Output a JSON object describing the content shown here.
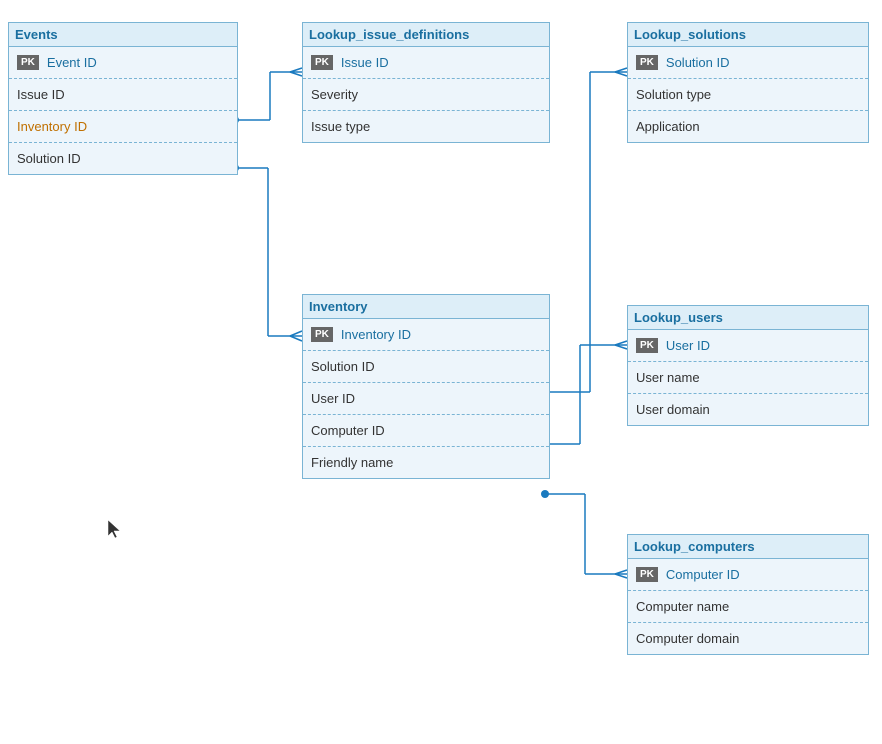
{
  "tables": {
    "events": {
      "title": "Events",
      "fields": [
        {
          "name": "Event ID",
          "type": "pk",
          "pk": true
        },
        {
          "name": "Issue ID",
          "type": "fk"
        },
        {
          "name": "Inventory ID",
          "type": "fk"
        },
        {
          "name": "Solution ID",
          "type": "fk"
        }
      ]
    },
    "lookup_issue_definitions": {
      "title": "Lookup_issue_definitions",
      "fields": [
        {
          "name": "Issue ID",
          "type": "pk",
          "pk": true
        },
        {
          "name": "Severity",
          "type": "normal"
        },
        {
          "name": "Issue type",
          "type": "normal"
        }
      ]
    },
    "lookup_solutions": {
      "title": "Lookup_solutions",
      "fields": [
        {
          "name": "Solution ID",
          "type": "pk",
          "pk": true
        },
        {
          "name": "Solution type",
          "type": "normal"
        },
        {
          "name": "Application",
          "type": "normal"
        }
      ]
    },
    "inventory": {
      "title": "Inventory",
      "fields": [
        {
          "name": "Inventory ID",
          "type": "pk",
          "pk": true
        },
        {
          "name": "Solution ID",
          "type": "fk"
        },
        {
          "name": "User ID",
          "type": "fk"
        },
        {
          "name": "Computer ID",
          "type": "fk"
        },
        {
          "name": "Friendly name",
          "type": "normal"
        }
      ]
    },
    "lookup_users": {
      "title": "Lookup_users",
      "fields": [
        {
          "name": "User ID",
          "type": "pk",
          "pk": true
        },
        {
          "name": "User name",
          "type": "normal"
        },
        {
          "name": "User domain",
          "type": "normal"
        }
      ]
    },
    "lookup_computers": {
      "title": "Lookup_computers",
      "fields": [
        {
          "name": "Computer ID",
          "type": "pk",
          "pk": true
        },
        {
          "name": "Computer name",
          "type": "normal"
        },
        {
          "name": "Computer domain",
          "type": "normal"
        }
      ]
    }
  }
}
